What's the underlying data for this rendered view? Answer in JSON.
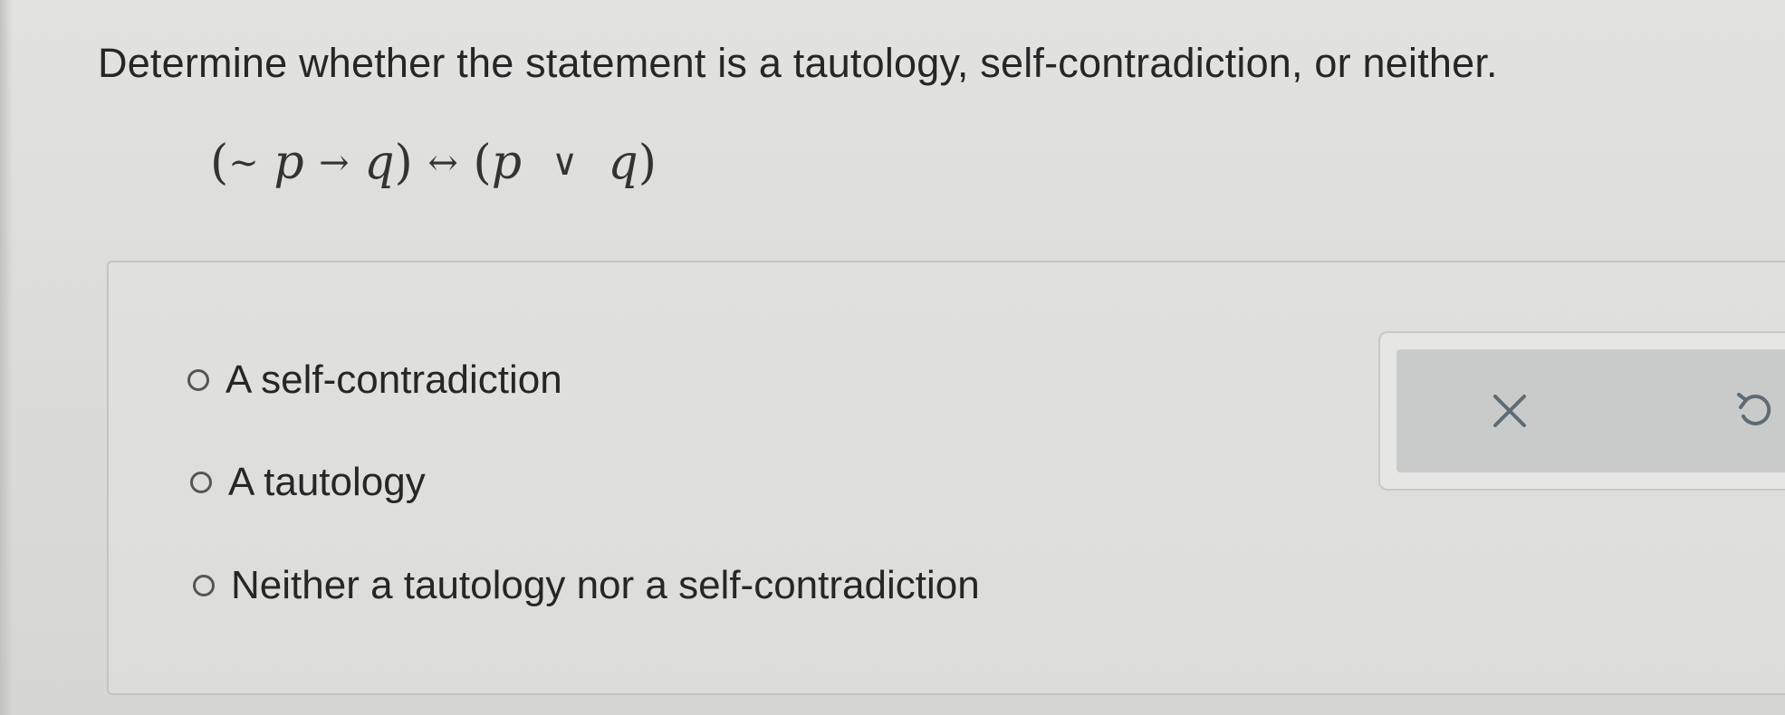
{
  "question": {
    "text": "Determine whether the statement is a tautology, self-contradiction, or neither."
  },
  "formula": {
    "open1": "(",
    "neg": "~",
    "p1": "p",
    "implies": "→",
    "q1": "q",
    "close1": ")",
    "biconditional": "↔",
    "open2": "(",
    "p2": "p",
    "or": "∨",
    "q2": "q",
    "close2": ")"
  },
  "options": [
    {
      "label": "A self-contradiction",
      "selected": false
    },
    {
      "label": "A tautology",
      "selected": false
    },
    {
      "label": "Neither a tautology nor a self-contradiction",
      "selected": false
    }
  ],
  "toolbar": {
    "clear_icon": "close-icon",
    "undo_icon": "undo-icon",
    "icon_color": "#5f6b73"
  }
}
